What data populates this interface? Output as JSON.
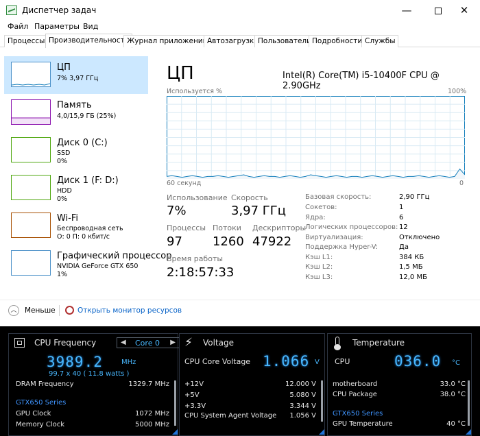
{
  "window": {
    "title": "Диспетчер задач",
    "controls": {
      "minimize": "—",
      "close": "✕"
    }
  },
  "menu": [
    "Файл",
    "Параметры",
    "Вид"
  ],
  "tabs": [
    "Процессы",
    "Производительность",
    "Журнал приложений",
    "Автозагрузка",
    "Пользователи",
    "Подробности",
    "Службы"
  ],
  "active_tab": "Производительность",
  "sidebar": [
    {
      "name": "ЦП",
      "sub1": "7%  3,97 ГГц",
      "sub2": "",
      "sub3": "",
      "graph_color": "#117dbb"
    },
    {
      "name": "Память",
      "sub1": "4,0/15,9 ГБ (25%)",
      "sub2": "",
      "sub3": "",
      "graph_color": "#8b12ae"
    },
    {
      "name": "Диск 0 (C:)",
      "sub1": "SSD",
      "sub2": "0%",
      "sub3": "",
      "graph_color": "#4da60c"
    },
    {
      "name": "Диск 1 (F: D:)",
      "sub1": "HDD",
      "sub2": "0%",
      "sub3": "",
      "graph_color": "#4da60c"
    },
    {
      "name": "Wi-Fi",
      "sub1": "Беспроводная сеть",
      "sub2": "О: 0 П: 0 кбит/с",
      "sub3": "",
      "graph_color": "#a74f01"
    },
    {
      "name": "Графический процессор",
      "sub1": "NVIDIA GeForce GTX 650",
      "sub2": "1%",
      "sub3": "",
      "graph_color": "#117dbb"
    }
  ],
  "cpu": {
    "title": "ЦП",
    "model": "Intel(R) Core(TM) i5-10400F CPU @ 2.90GHz",
    "util_label": "Используется %",
    "util_max": "100%",
    "axis_left": "60 секунд",
    "axis_right": "0",
    "graph_color": "#117dbb",
    "utilization_history": [
      3,
      4,
      3,
      2,
      3,
      4,
      3,
      2,
      3,
      3,
      4,
      3,
      2,
      3,
      4,
      5,
      3,
      2,
      3,
      4,
      3,
      3,
      2,
      3,
      4,
      3,
      2,
      3,
      5,
      4,
      3,
      2,
      3,
      4,
      3,
      2,
      3,
      3,
      2,
      3,
      4,
      3,
      2,
      3,
      4,
      3,
      2,
      3,
      3,
      4,
      3,
      2,
      3,
      4,
      3,
      2,
      3,
      12,
      5
    ],
    "stats": {
      "usage_label": "Использование",
      "usage_value": "7%",
      "speed_label": "Скорость",
      "speed_value": "3,97 ГГц",
      "processes_label": "Процессы",
      "processes_value": "97",
      "threads_label": "Потоки",
      "threads_value": "1260",
      "handles_label": "Дескрипторы",
      "handles_value": "47922",
      "uptime_label": "Время работы",
      "uptime_value": "2:18:57:33"
    },
    "specs": [
      {
        "label": "Базовая скорость:",
        "value": "2,90 ГГц"
      },
      {
        "label": "Сокетов:",
        "value": "1"
      },
      {
        "label": "Ядра:",
        "value": "6"
      },
      {
        "label": "Логических процессоров:",
        "value": "12"
      },
      {
        "label": "Виртуализация:",
        "value": "Отключено"
      },
      {
        "label": "Поддержка Hyper-V:",
        "value": "Да"
      },
      {
        "label": "Кэш L1:",
        "value": "384 КБ"
      },
      {
        "label": "Кэш L2:",
        "value": "1,5 МБ"
      },
      {
        "label": "Кэш L3:",
        "value": "12,0 МБ"
      }
    ]
  },
  "footer": {
    "fewer_icon": "chevron-up",
    "fewer_label": "Меньше",
    "resmon_label": "Открыть монитор ресурсов"
  },
  "hw_freq": {
    "title": "CPU Frequency",
    "core_select": "Core 0",
    "big_value": "3989.2",
    "unit": "MHz",
    "detail": "99.7  x  40    ( 11.8   watts )",
    "rows": [
      {
        "label": "DRAM Frequency",
        "value": "1329.7  MHz"
      }
    ],
    "section": "GTX650 Series",
    "section_rows": [
      {
        "label": "GPU Clock",
        "value": "1072 MHz"
      },
      {
        "label": "Memory Clock",
        "value": "5000 MHz"
      }
    ]
  },
  "hw_volt": {
    "title": "Voltage",
    "main_label": "CPU Core Voltage",
    "big_value": "1.066",
    "unit": "V",
    "rows": [
      {
        "label": "+12V",
        "value": "12.000  V"
      },
      {
        "label": "+5V",
        "value": "5.080  V"
      },
      {
        "label": "+3.3V",
        "value": "3.344  V"
      },
      {
        "label": "CPU System Agent Voltage",
        "value": "1.056  V"
      }
    ]
  },
  "hw_temp": {
    "title": "Temperature",
    "main_label": "CPU",
    "big_value": "036.0",
    "unit": "°C",
    "rows": [
      {
        "label": "motherboard",
        "value": "33.0 °C"
      },
      {
        "label": "CPU Package",
        "value": "38.0 °C"
      }
    ],
    "section": "GTX650 Series",
    "section_rows": [
      {
        "label": "GPU Temperature",
        "value": "40 °C"
      }
    ]
  }
}
